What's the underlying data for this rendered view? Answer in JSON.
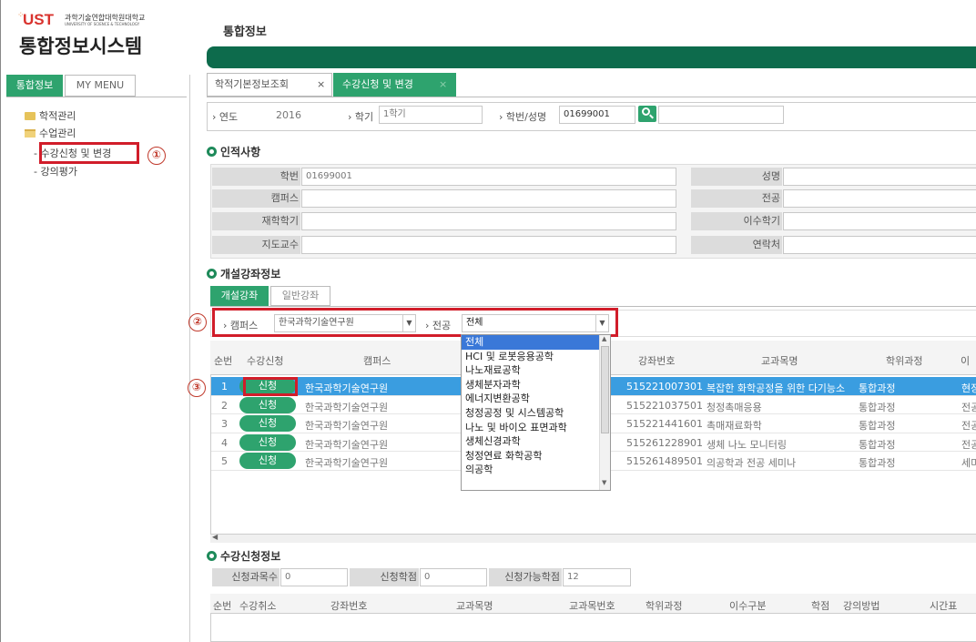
{
  "logo": {
    "mark": "UST",
    "subtitle_kr": "과학기술연합대학원대학교",
    "subtitle_en": "UNIVERSITY OF SCIENCE & TECHNOLOGY",
    "system_title": "통합정보시스템"
  },
  "sidebar": {
    "tabs": [
      "통합정보",
      "MY MENU"
    ],
    "tree": [
      {
        "label": "학적관리",
        "type": "folder"
      },
      {
        "label": "수업관리",
        "type": "folder-open"
      },
      {
        "label": "수강신청 및 변경",
        "type": "child"
      },
      {
        "label": "강의평가",
        "type": "child"
      }
    ]
  },
  "header": {
    "title": "통합정보"
  },
  "page_tabs": [
    "학적기본정보조회",
    "수강신청 및 변경"
  ],
  "search": {
    "year_label": "연도",
    "year_value": "2016",
    "term_label": "학기",
    "term_value": "1학기",
    "id_label": "학번/성명",
    "id_value": "01699001",
    "name_value": ""
  },
  "personal": {
    "title": "인적사항",
    "rows": [
      {
        "l1": "학번",
        "v1": "01699001",
        "l2": "성명",
        "v2": ""
      },
      {
        "l1": "캠퍼스",
        "v1": "",
        "l2": "전공",
        "v2": ""
      },
      {
        "l1": "재학학기",
        "v1": "",
        "l2": "이수학기",
        "v2": ""
      },
      {
        "l1": "지도교수",
        "v1": "",
        "l2": "연락처",
        "v2": ""
      }
    ]
  },
  "courses": {
    "title": "개설강좌정보",
    "tabs": [
      "개설강좌",
      "일반강좌"
    ],
    "campus_label": "캠퍼스",
    "campus_value": "한국과학기술연구원",
    "major_label": "전공",
    "major_value": "전체",
    "headers": [
      "순번",
      "수강신청",
      "캠퍼스",
      "강좌번호",
      "교과목명",
      "학위과정",
      "이"
    ],
    "rows": [
      {
        "no": "1",
        "btn": "신청",
        "campus": "한국과학기술연구원",
        "code": "515221007301",
        "subject": "복잡한 화학공정을 위한 다기능소",
        "degree": "통합과정",
        "etc": "현장"
      },
      {
        "no": "2",
        "btn": "신청",
        "campus": "한국과학기술연구원",
        "code": "515221037501",
        "subject": "청정촉매응용",
        "degree": "통합과정",
        "etc": "전공"
      },
      {
        "no": "3",
        "btn": "신청",
        "campus": "한국과학기술연구원",
        "code": "515221441601",
        "subject": "촉매재료화학",
        "degree": "통합과정",
        "etc": "전공"
      },
      {
        "no": "4",
        "btn": "신청",
        "campus": "한국과학기술연구원",
        "code": "515261228901",
        "subject": "생체 나노 모니터링",
        "degree": "통합과정",
        "etc": "전공"
      },
      {
        "no": "5",
        "btn": "신청",
        "campus": "한국과학기술연구원",
        "code": "515261489501",
        "subject": "의공학과 전공 세미나",
        "degree": "통합과정",
        "etc": "세미"
      }
    ],
    "dropdown": [
      "전체",
      "HCI 및 로봇응용공학",
      "나노재료공학",
      "생체분자과학",
      "에너지변환공학",
      "청정공정 및 시스템공학",
      "나노 및 바이오 표면과학",
      "생체신경과학",
      "청정연료 화학공학",
      "의공학"
    ]
  },
  "registration": {
    "title": "수강신청정보",
    "count_label": "신청과목수",
    "count_value": "0",
    "credit_label": "신청학점",
    "credit_value": "0",
    "avail_label": "신청가능학점",
    "avail_value": "12",
    "headers": [
      "순번",
      "수강취소",
      "강좌번호",
      "교과목명",
      "교과목번호",
      "학위과정",
      "이수구분",
      "학점",
      "강의방법",
      "시간표"
    ]
  },
  "markers": [
    "①",
    "②",
    "③"
  ],
  "colors": {
    "accent": "#1e8a5a",
    "header_bar": "#0d6b4c",
    "button": "#2ea36e",
    "highlight": "#d11d2a",
    "row_selected": "#3a9de0"
  }
}
